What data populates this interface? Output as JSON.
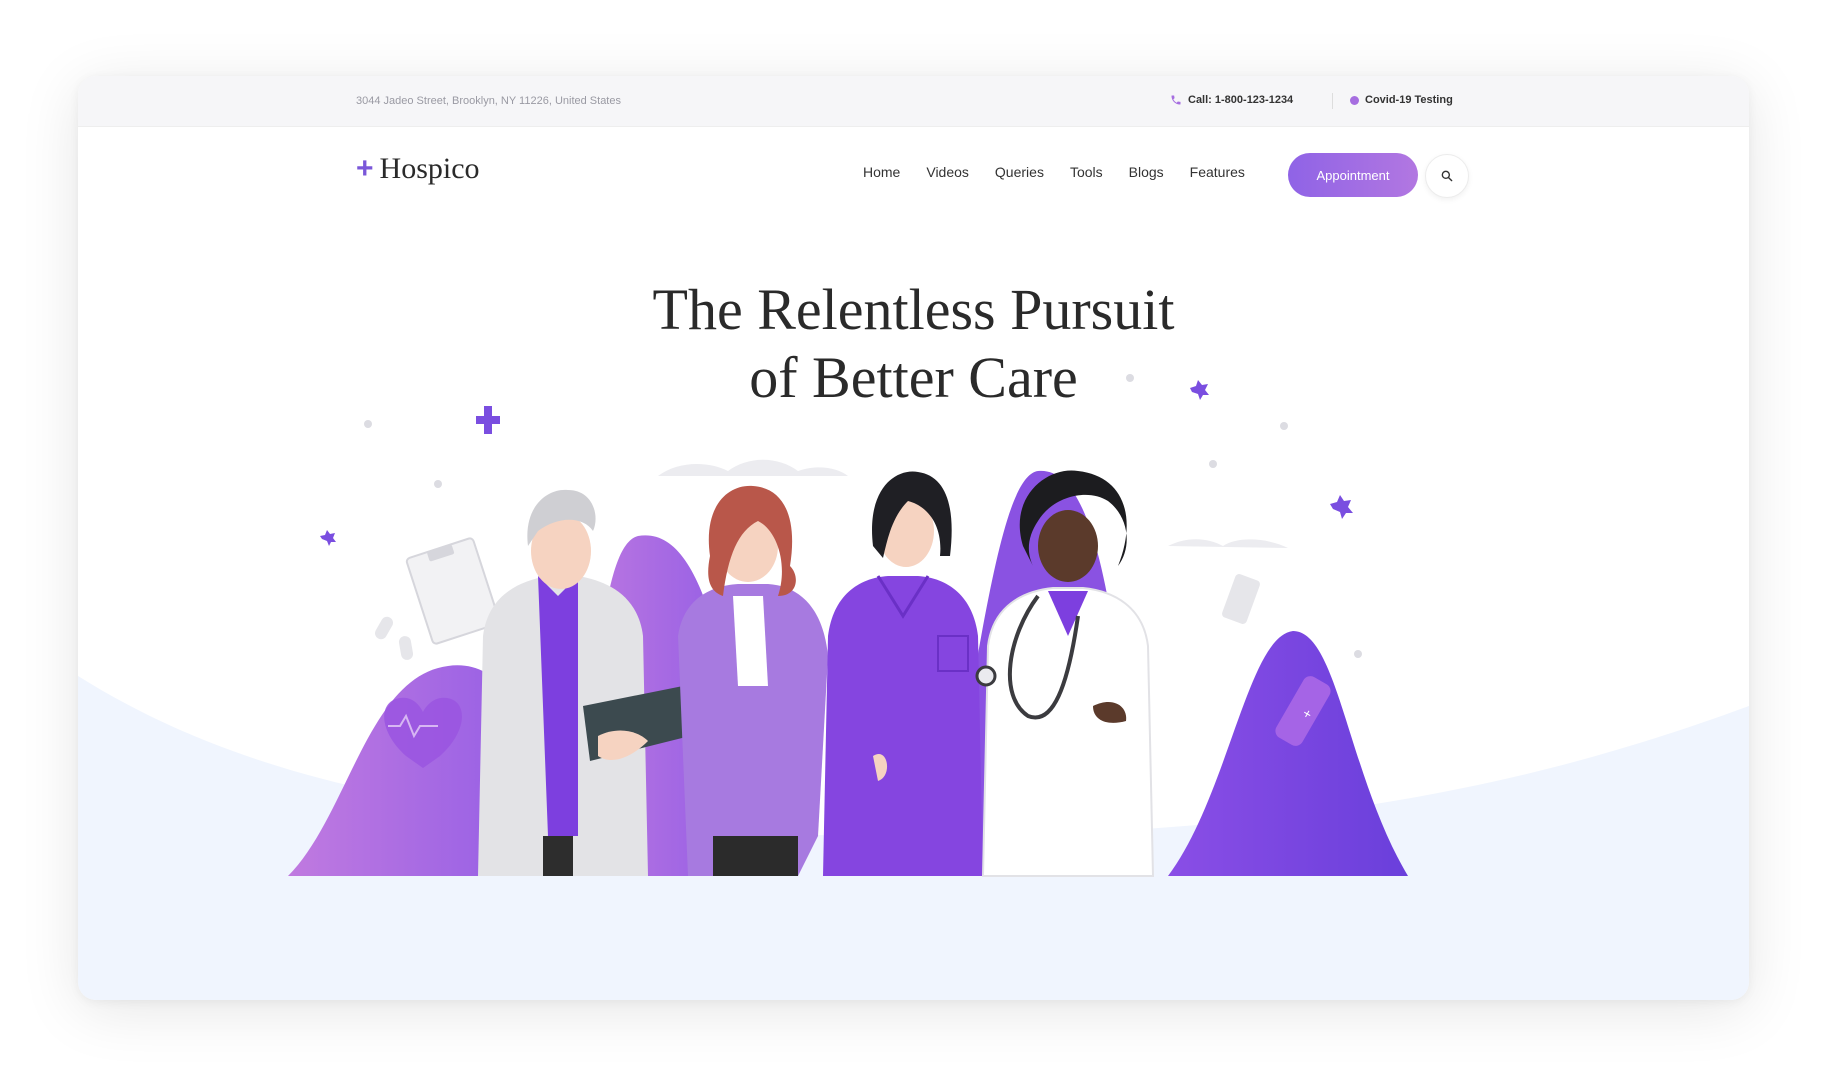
{
  "topbar": {
    "address": "3044 Jadeo Street, Brooklyn, NY 11226, United States",
    "call": "Call: 1-800-123-1234",
    "covid": "Covid-19 Testing"
  },
  "brand": {
    "name": "Hospico"
  },
  "nav": {
    "items": [
      "Home",
      "Videos",
      "Queries",
      "Tools",
      "Blogs",
      "Features"
    ],
    "cta": "Appointment"
  },
  "hero": {
    "title_line1": "The Relentless Pursuit",
    "title_line2": "of Better Care"
  },
  "colors": {
    "accent": "#7a57d9",
    "accent_light": "#b277e1",
    "lavender_bg": "#f0f5fe",
    "purple_shape": "#8f4fe0"
  },
  "icons": [
    "plus-logo-icon",
    "phone-icon",
    "covid-dot-icon",
    "search-icon",
    "heart-icon",
    "stethoscope-icon"
  ]
}
